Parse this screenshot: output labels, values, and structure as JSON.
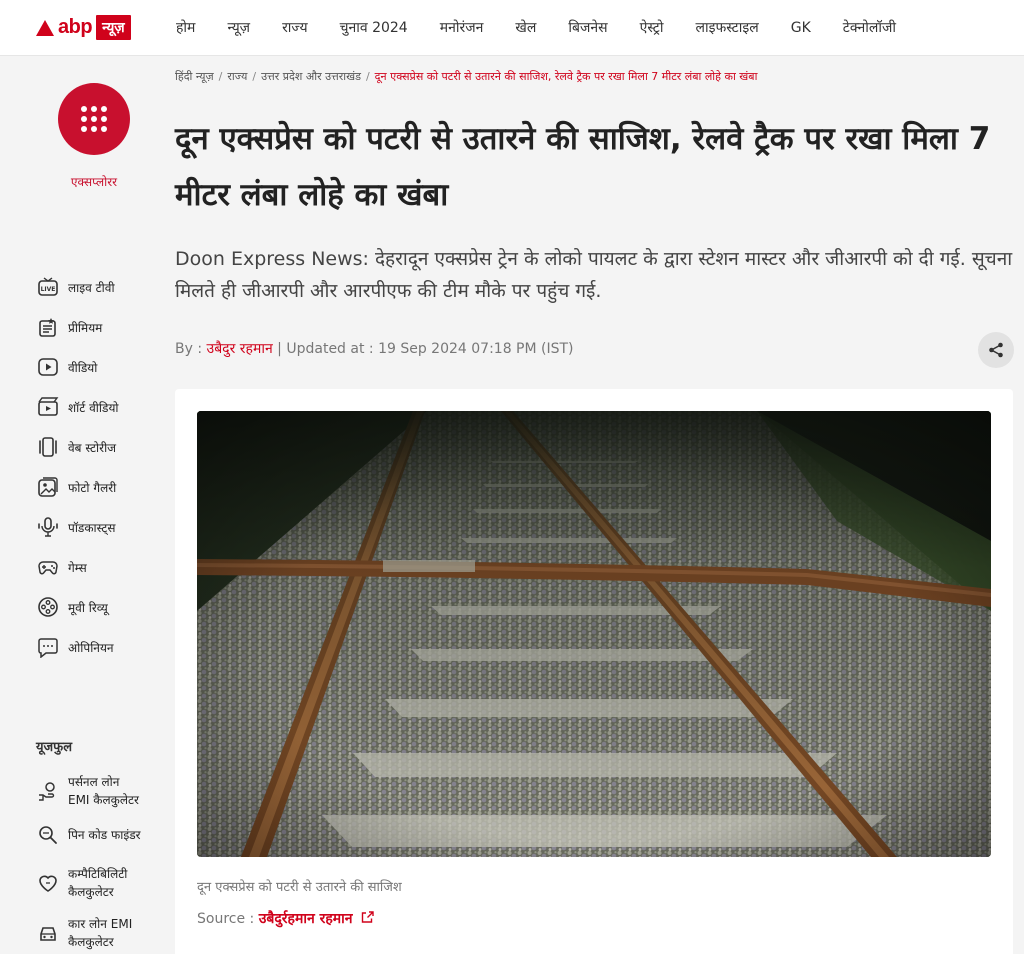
{
  "brand": {
    "name": "abp",
    "box": "न्यूज़",
    "accent": "#d0021b"
  },
  "nav": [
    "होम",
    "न्यूज़",
    "राज्य",
    "चुनाव 2024",
    "मनोरंजन",
    "खेल",
    "बिजनेस",
    "ऐस्ट्रो",
    "लाइफस्टाइल",
    "GK",
    "टेक्नोलॉजी"
  ],
  "sidebar": {
    "explorer_label": "एक्सप्लोरर",
    "items": [
      {
        "label": "लाइव टीवी",
        "icon": "live-tv-icon"
      },
      {
        "label": "प्रीमियम",
        "icon": "premium-icon"
      },
      {
        "label": "वीडियो",
        "icon": "video-icon"
      },
      {
        "label": "शॉर्ट वीडियो",
        "icon": "short-video-icon"
      },
      {
        "label": "वेब स्टोरीज",
        "icon": "web-stories-icon"
      },
      {
        "label": "फोटो गैलरी",
        "icon": "photo-gallery-icon"
      },
      {
        "label": "पॉडकास्ट्स",
        "icon": "podcast-icon"
      },
      {
        "label": "गेम्स",
        "icon": "games-icon"
      },
      {
        "label": "मूवी रिव्यू",
        "icon": "movie-review-icon"
      },
      {
        "label": "ओपिनियन",
        "icon": "opinion-icon"
      }
    ],
    "useful_title": "यूजफुल",
    "useful": [
      {
        "line1": "पर्सनल लोन",
        "line2": "EMI कैलकुलेटर",
        "icon": "loan-icon"
      },
      {
        "line1": "पिन कोड फाइंडर",
        "line2": "",
        "icon": "pincode-icon"
      },
      {
        "line1": "कम्पैटिबिलिटी",
        "line2": "कैलकुलेटर",
        "icon": "heart-icon"
      },
      {
        "line1": "कार लोन EMI",
        "line2": "कैलकुलेटर",
        "icon": "car-icon"
      }
    ]
  },
  "breadcrumb": [
    "हिंदी न्यूज़",
    "राज्य",
    "उत्तर प्रदेश और उत्तराखंड",
    "दून एक्सप्रेस को पटरी से उतारने की साजिश, रेलवे ट्रैक पर रखा मिला 7 मीटर लंबा लोहे का खंबा"
  ],
  "article": {
    "headline": "दून एक्सप्रेस को पटरी से उतारने की साजिश, रेलवे ट्रैक पर रखा मिला 7 मीटर लंबा लोहे का खंबा",
    "summary": "Doon Express News: देहरादून एक्सप्रेस ट्रेन के लोको पायलट के द्वारा स्टेशन मास्टर और जीआरपी को दी गई. सूचना मिलते ही जीआरपी और आरपीएफ की टीम मौके पर पहुंच गई.",
    "by_label": "By : ",
    "author": "उबैदुर रहमान",
    "updated": " | Updated at : 19 Sep 2024 07:18 PM (IST)",
    "caption": "दून एक्सप्रेस को पटरी से उतारने की साजिश",
    "source_label": "Source : ",
    "source_name": "उबैदुर्रहमान रहमान"
  }
}
